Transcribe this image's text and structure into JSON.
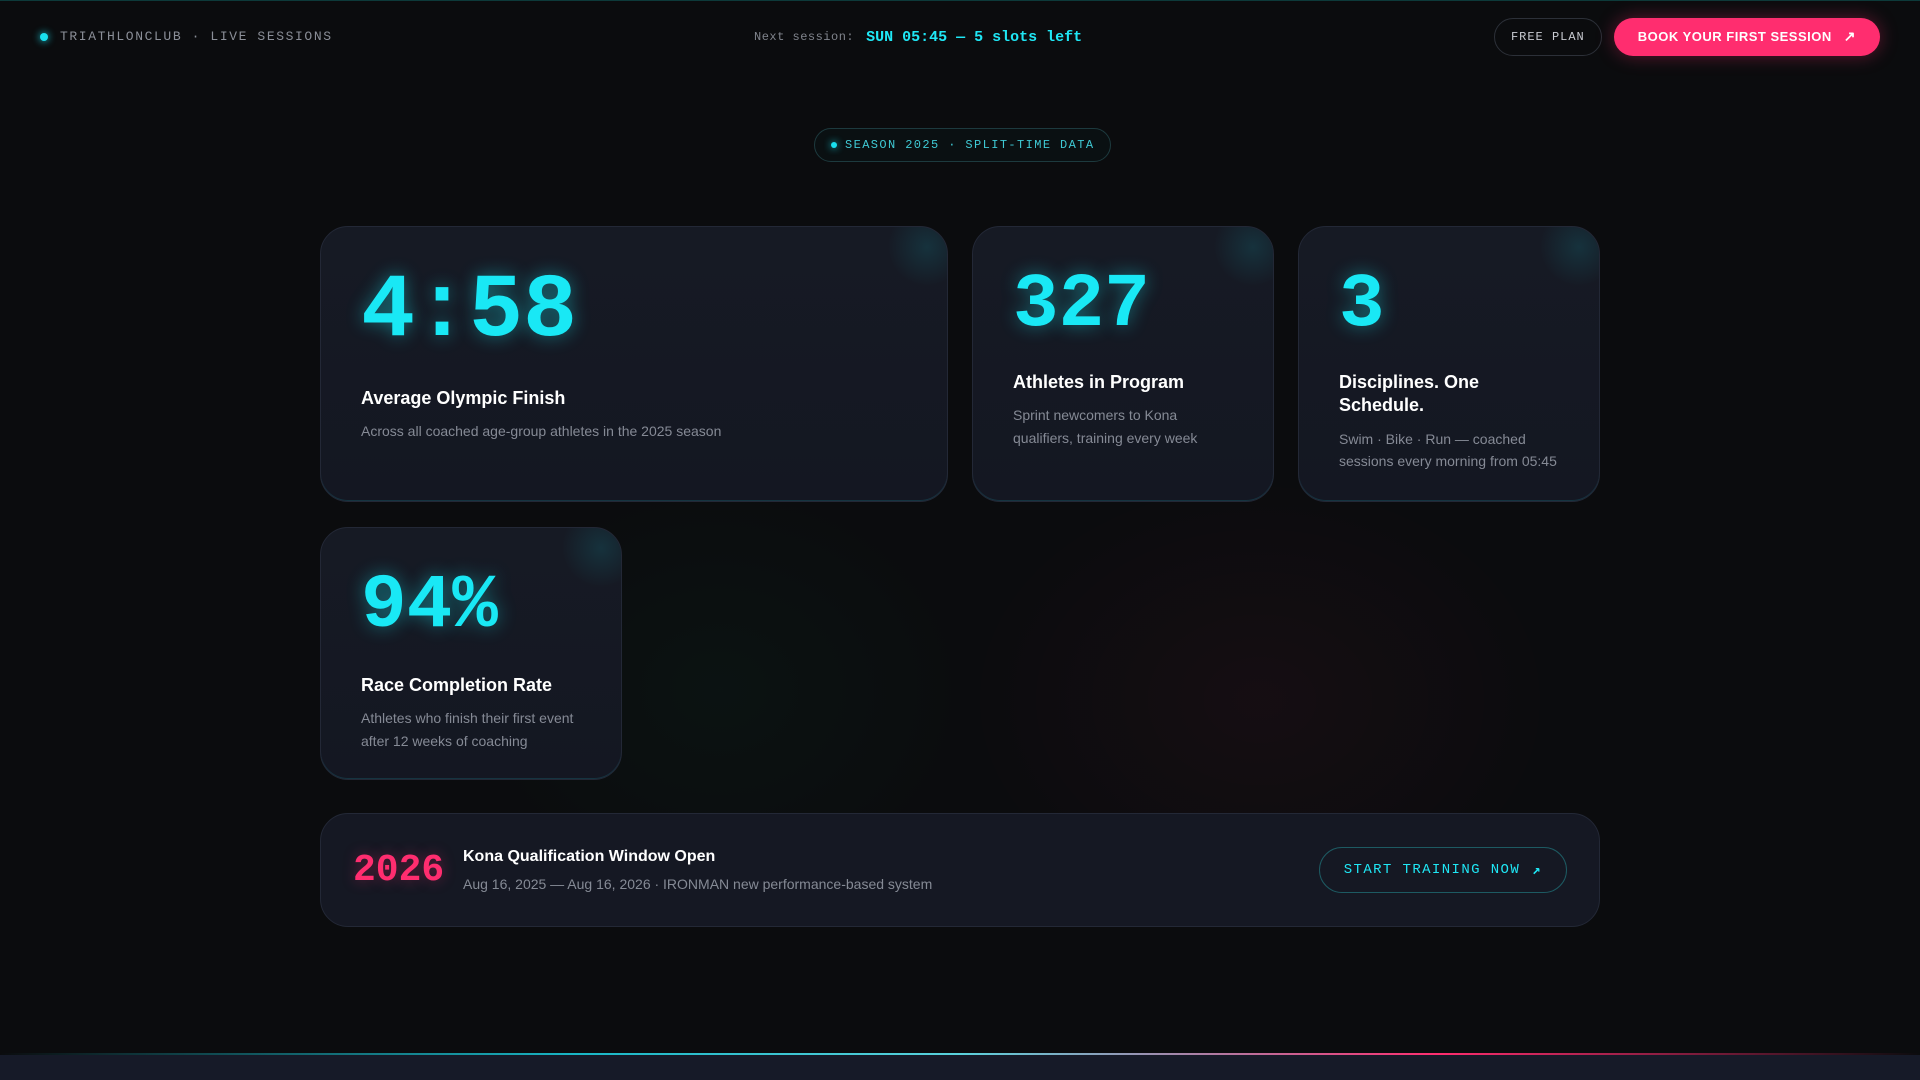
{
  "header": {
    "brand": "TRIATHLONCLUB · LIVE SESSIONS",
    "next_label": "Next session:",
    "next_value": "SUN 05:45 — 5 slots left",
    "free_plan": "FREE PLAN",
    "book_button": "BOOK YOUR FIRST SESSION",
    "book_icon": "arrow-up-right-icon"
  },
  "season_pill": "SEASON 2025 · SPLIT-TIME DATA",
  "stats": {
    "finish": {
      "value": "4:58",
      "title": "Average Olympic Finish",
      "desc": "Across all coached age-group athletes in the 2025 season"
    },
    "athletes": {
      "value": "327",
      "title": "Athletes in Program",
      "desc": "Sprint newcomers to Kona qualifiers, training every week"
    },
    "disciplines": {
      "value": "3",
      "title": "Disciplines. One Schedule.",
      "desc": "Swim · Bike · Run — coached sessions every morning from 05:45"
    },
    "completion": {
      "value": "94%",
      "title": "Race Completion Rate",
      "desc": "Athletes who finish their first event after 12 weeks of coaching"
    }
  },
  "banner": {
    "year": "2026",
    "title": "Kona Qualification Window Open",
    "subtitle": "Aug 16, 2025 — Aug 16, 2026 · IRONMAN new performance-based system",
    "button": "START TRAINING NOW",
    "button_icon": "arrow-up-right-icon"
  },
  "colors": {
    "accent_cyan": "#19e8f5",
    "accent_pink": "#ff2d6f",
    "background": "#0b0c0e"
  }
}
